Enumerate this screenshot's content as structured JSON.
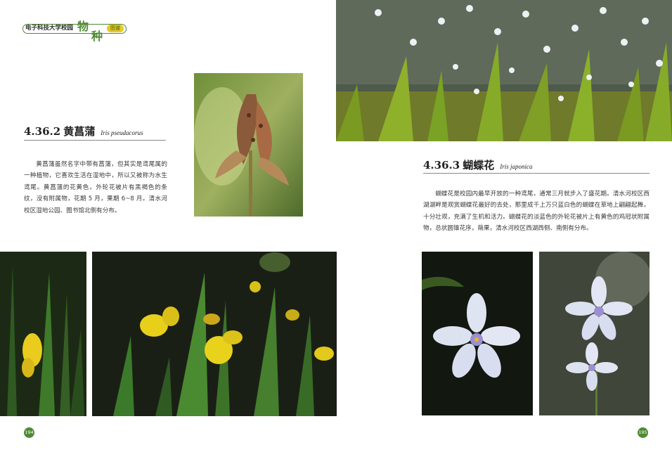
{
  "header": {
    "school": "电子科技大学校园",
    "char1": "物",
    "char2": "种",
    "tag": "图谱"
  },
  "left": {
    "section_number": "4.36.2",
    "title_cn": "黄菖蒲",
    "title_latin": "Iris pseudacorus",
    "body": "黄菖蒲虽然名字中带有菖蒲，但其实是鸢尾属的一种植物，它喜欢生活在湿地中，所以又被称为水生鸢尾。黄菖蒲的花黄色，外轮花被片有黑褐色的条纹，没有附属物，花期 5 月，果期 6~8 月。清水河校区湿地公园、图书馆北侧有分布。",
    "page_number": "194"
  },
  "right": {
    "section_number": "4.36.3",
    "title_cn": "蝴蝶花",
    "title_latin": "Iris japonica",
    "body": "蝴蝶花是校园内最早开放的一种鸢尾，通常三月就步入了盛花期。清水河校区西湖湖畔是观赏蝴蝶花最好的去处，那里成千上万只蓝白色的蝴蝶在草地上翩翩起舞，十分壮观，充满了生机和活力。蝴蝶花的淡蓝色的外轮花被片上有黄色的鸡冠状附属物，总状圆锥花序，蒴果，清水河校区西湖西侧、南侧有分布。",
    "page_number": "195"
  },
  "colors": {
    "accent_green": "#4f8a35",
    "tag_yellow": "#e9c825"
  },
  "icons": [
    "logo-pill"
  ]
}
